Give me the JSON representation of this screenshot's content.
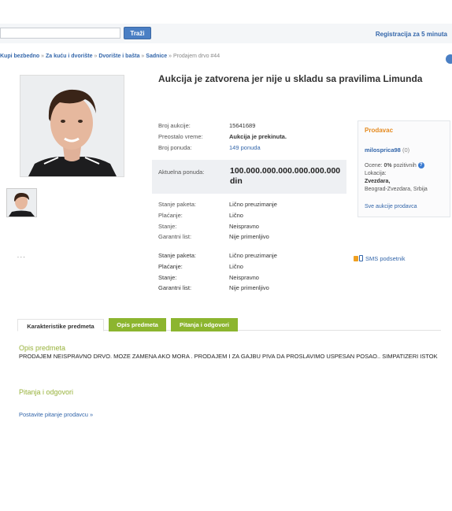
{
  "search": {
    "placeholder": "",
    "button_label": "Traži"
  },
  "register_label": "Registracija za 5 minuta",
  "breadcrumb": {
    "items": [
      "Kupi bezbedno",
      "Za kuću i dvorište",
      "Dvorište i bašta",
      "Sadnice"
    ],
    "separator": "»",
    "current": "Prodajem drvo #44"
  },
  "listing": {
    "title": "Aukcija je zatvorena jer nije u skladu sa pravilima Limunda",
    "auction_label": "Broj aukcije:",
    "auction_value": "15641689",
    "remaining_label": "Preostalo vreme:",
    "remaining_value": "Aukcija je prekinuta.",
    "bids_label": "Broj ponuda:",
    "bids_value": "149 ponuda",
    "price_label": "Aktuelna ponuda:",
    "price_value": "100.000.000.000.000.000.000 din",
    "details": [
      {
        "label": "Stanje paketa:",
        "value": "Lično preuzimanje"
      },
      {
        "label": "Plaćanje:",
        "value": "Lično"
      },
      {
        "label": "Stanje:",
        "value": "Neispravno"
      },
      {
        "label": "Garantni list:",
        "value": "Nije primenljivo"
      }
    ],
    "details_repeat": [
      {
        "label": "Stanje paketa:",
        "value": "Lično preuzimanje"
      },
      {
        "label": "Plaćanje:",
        "value": "Lično"
      },
      {
        "label": "Stanje:",
        "value": "Neispravno"
      },
      {
        "label": "Garantni list:",
        "value": "Nije primenljivo"
      }
    ]
  },
  "seller": {
    "heading": "Prodavac",
    "name": "milosprica98",
    "rating_count": "(0)",
    "rating_text_prefix": "Ocene:",
    "rating_percent": "0%",
    "rating_text_suffix": "pozitivnih",
    "location_label": "Lokacija:",
    "location_city": "Zvezdara,",
    "location_full": "Beograd-Zvezdara, Srbija",
    "all_auctions_link": "Sve aukcije prodavca"
  },
  "sms_label": "SMS podsetnik",
  "dots": ". . .",
  "tabs": [
    "Karakteristike predmeta",
    "Opis predmeta",
    "Pitanja i odgovori"
  ],
  "description": {
    "title": "Opis predmeta",
    "text": "PRODAJEM NEISPRAVNO DRVO. MOZE ZAMENA AKO MORA . PRODAJEM I ZA GAJBU PIVA DA PROSLAVIMO USPESAN POSAO.. SIMPATIZERI ISTOK"
  },
  "qa": {
    "title": "Pitanja i odgovori",
    "ask_link": "Postavite pitanje prodavcu »"
  },
  "colors": {
    "link": "#3366aa",
    "accent_green": "#8cb52f",
    "seller_orange": "#e58a1f",
    "section_title": "#98b23b"
  }
}
